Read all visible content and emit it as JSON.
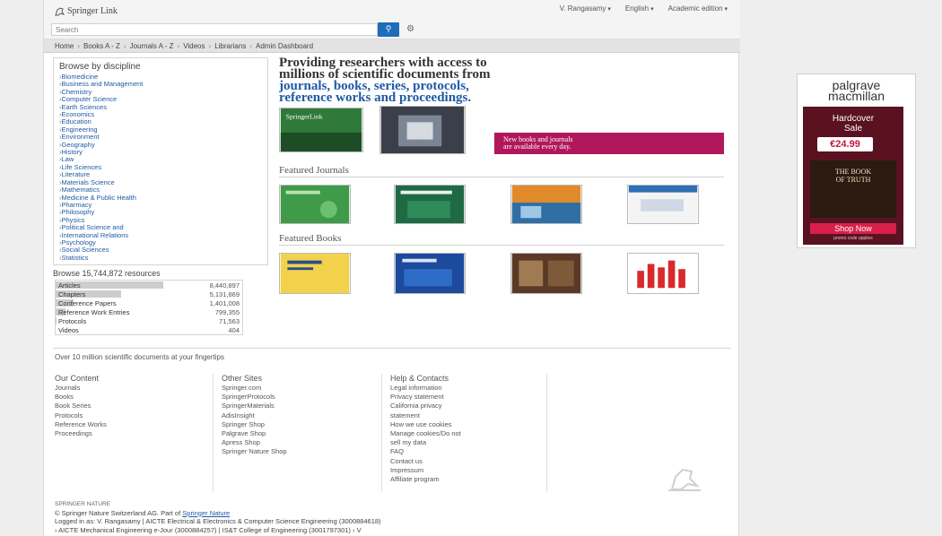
{
  "header": {
    "logo": "Springer Link",
    "user": "V. Rangasamy",
    "language": "English",
    "edition": "Academic edition",
    "search_placeholder": "Search"
  },
  "nav": [
    "Home",
    "Books A - Z",
    "Journals A - Z",
    "Videos",
    "Librarians",
    "Admin Dashboard"
  ],
  "sidebar": {
    "title": "Browse by discipline",
    "disciplines": [
      "Biomedicine",
      "Business and Management",
      "Chemistry",
      "Computer Science",
      "Earth Sciences",
      "Economics",
      "Education",
      "Engineering",
      "Environment",
      "Geography",
      "History",
      "Law",
      "Life Sciences",
      "Literature",
      "Materials Science",
      "Mathematics",
      "Medicine & Public Health",
      "Pharmacy",
      "Philosophy",
      "Physics",
      "Political Science and",
      "International Relations",
      "Psychology",
      "Social Sciences",
      "Statistics"
    ],
    "resources_title": "Browse 15,744,872 resources",
    "resources": [
      {
        "label": "Articles",
        "value": "8,440,897",
        "fraction": 1.0
      },
      {
        "label": "Chapters",
        "value": "5,131,869",
        "fraction": 0.61
      },
      {
        "label": "Conference Papers",
        "value": "1,401,008",
        "fraction": 0.17
      },
      {
        "label": "Reference Work Entries",
        "value": "799,355",
        "fraction": 0.09
      },
      {
        "label": "Protocols",
        "value": "71,563",
        "fraction": 0.01
      },
      {
        "label": "Videos",
        "value": "404",
        "fraction": 0.0
      }
    ]
  },
  "main": {
    "tagline_1": "Providing researchers with access to",
    "tagline_2": "millions of scientific documents from",
    "tagline_3": "journals, books, series, protocols,",
    "tagline_4": "reference works and proceedings.",
    "promo_line_1": "New books and journals",
    "promo_line_2": "are available every day.",
    "featured_journals": "Featured Journals",
    "featured_books": "Featured Books"
  },
  "footer": {
    "tagline": "Over 10 million scientific documents at your fingertips",
    "col1_title": "Our Content",
    "col1_links": [
      "Journals",
      "Books",
      "Book Series",
      "Protocols",
      "Reference Works",
      "Proceedings"
    ],
    "col2_title": "Other Sites",
    "col2_links": [
      "Springer.com",
      "SpringerProtocols",
      "SpringerMaterials",
      "AdisInsight",
      "Springer Shop",
      "Palgrave Shop",
      "Apress Shop",
      "Springer Nature Shop"
    ],
    "col3_title": "Help & Contacts",
    "col3_links": [
      "Legal information",
      "Privacy statement",
      "California privacy",
      "statement",
      "How we use cookies",
      "Manage cookies/Do not",
      "sell my data",
      "FAQ",
      "Contact us",
      "Impressum",
      "Affiliate program"
    ],
    "copyright_label": "SPRINGER NATURE",
    "copyright_line": "© Springer Nature Switzerland AG. Part of",
    "copyright_link": "Springer Nature",
    "logged_in": "Logged in as: V. Rangasamy | AICTE Electrical & Electronics & Computer Science Engineering (3000884618)",
    "logged_in_2": "› AICTE Mechanical Engineering e-Jour (3000884257) | IS&T College of Engineering (3001797301) › V"
  },
  "ad": {
    "brand": "palgrave",
    "brand_2": "macmillan",
    "sale": "Hardcover",
    "sale_2": "Sale",
    "price": "€24.99",
    "book_title": "THE BOOK",
    "book_title_2": "OF TRUTH",
    "shop": "Shop Now",
    "small": "promo code applies"
  },
  "colors": {
    "link": "#1f5aa6",
    "promo": "#b0185b",
    "search_button": "#1f6cb8",
    "ad_panel": "#5a1220"
  }
}
